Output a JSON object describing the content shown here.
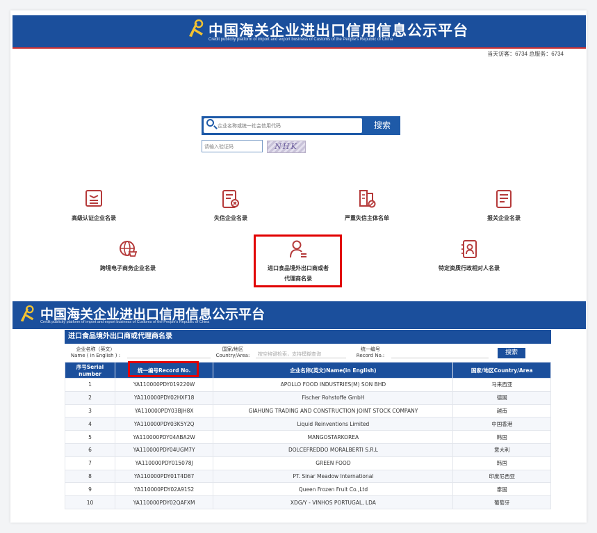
{
  "header": {
    "title": "中国海关企业进出口信用信息公示平台",
    "subtitle": "Credit publicity platform of import and export business of Customs of the People's Republic of China",
    "visitors": "当天访客：6734   总服务：6734"
  },
  "search": {
    "placeholder": "企业名称或统一社会信用代码",
    "button": "搜索",
    "captcha_placeholder": "请输入验证码",
    "captcha_text": "NHK"
  },
  "categories": [
    {
      "label": "高级认证企业名录",
      "icon": "certificate-icon"
    },
    {
      "label": "失信企业名录",
      "icon": "blacklist-doc-icon"
    },
    {
      "label": "严重失信主体名单",
      "icon": "serious-dishonest-icon"
    },
    {
      "label": "报关企业名录",
      "icon": "declaration-list-icon"
    },
    {
      "label": "跨境电子商务企业名录",
      "icon": "ecommerce-globe-icon"
    },
    {
      "label": "进口食品境外出口商或者",
      "label2": "代理商名录",
      "icon": "exporter-person-icon"
    },
    {
      "label": "特定资质行政相对人名录",
      "icon": "qualification-icon"
    }
  ],
  "section": {
    "title": "进口食品境外出口商或代理商名录",
    "filter_name_cn": "企业名称（英文）",
    "filter_name_en": "Name ( in English ) :",
    "filter_country_cn": "国家/地区",
    "filter_country_en": "Country/Area:",
    "filter_country_placeholder": "按空格键检索，支持模糊查询",
    "filter_record_cn": "统一编号",
    "filter_record_en": "Record No.:",
    "search_button": "搜索"
  },
  "table": {
    "headers": [
      "序号Serial number",
      "统一编号Record No.",
      "企业名称(英文)Name(in English)",
      "国家/地区Country/Area"
    ],
    "rows": [
      [
        "1",
        "YA110000PDY019220W",
        "APOLLO FOOD INDUSTRIES(M) SON BHD",
        "马来西亚"
      ],
      [
        "2",
        "YA110000PDY02HXF18",
        "Fischer Rohstoffe GmbH",
        "德国"
      ],
      [
        "3",
        "YA110000PDY03BJH8X",
        "GIAHUNG TRADING AND CONSTRUCTION JOINT STOCK COMPANY",
        "越南"
      ],
      [
        "4",
        "YA110000PDY03K5Y2Q",
        "Liquid Reinventions Limited",
        "中国香港"
      ],
      [
        "5",
        "YA110000PDY04ABA2W",
        "MANGOSTARKOREA",
        "韩国"
      ],
      [
        "6",
        "YA110000PDY04UGM7Y",
        "DOLCEFREDDO MORALBERTI S.R.L",
        "意大利"
      ],
      [
        "7",
        "YA110000PDY015078J",
        "GREEN FOOD",
        "韩国"
      ],
      [
        "8",
        "YA110000PDY01T4D87",
        "PT. Sinar Meadow International",
        "印度尼西亚"
      ],
      [
        "9",
        "YA110000PDY02A91S2",
        "Queen Frozen Fruit Co.,Ltd",
        "泰国"
      ],
      [
        "10",
        "YA110000PDY02QAFXM",
        "XDG/Y - VINHOS PORTUGAL, LDA",
        "葡萄牙"
      ]
    ]
  },
  "colors": {
    "brand_blue": "#1b4f9c",
    "highlight_red": "#e10000",
    "icon_red": "#b53a3a"
  }
}
